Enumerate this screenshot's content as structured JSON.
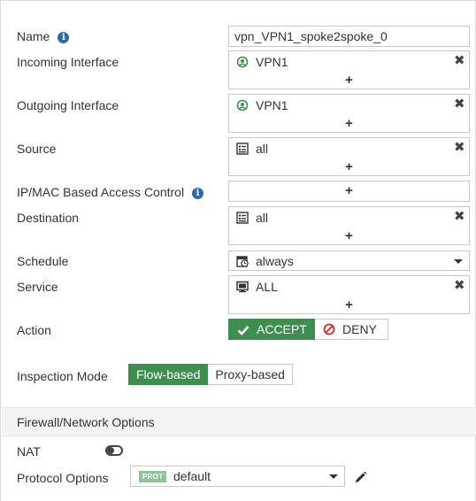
{
  "form": {
    "name": {
      "label": "Name",
      "value": "vpn_VPN1_spoke2spoke_0"
    },
    "incoming_interface": {
      "label": "Incoming Interface",
      "entry": "VPN1"
    },
    "outgoing_interface": {
      "label": "Outgoing Interface",
      "entry": "VPN1"
    },
    "source": {
      "label": "Source",
      "entry": "all"
    },
    "ipmac": {
      "label": "IP/MAC Based Access Control"
    },
    "destination": {
      "label": "Destination",
      "entry": "all"
    },
    "schedule": {
      "label": "Schedule",
      "value": "always"
    },
    "service": {
      "label": "Service",
      "entry": "ALL"
    },
    "action": {
      "label": "Action",
      "accept": "ACCEPT",
      "deny": "DENY",
      "selected": "ACCEPT"
    },
    "inspection_mode": {
      "label": "Inspection Mode",
      "flow": "Flow-based",
      "proxy": "Proxy-based",
      "selected": "Flow-based"
    }
  },
  "section": {
    "title": "Firewall/Network Options"
  },
  "nat": {
    "label": "NAT",
    "enabled": false
  },
  "protocol_options": {
    "label": "Protocol Options",
    "badge": "PROT",
    "value": "default"
  },
  "symbols": {
    "info": "i",
    "remove": "✖",
    "add": "+"
  },
  "colors": {
    "accent_green": "#3e8e4f",
    "info_blue": "#2a6bb3",
    "deny_red": "#d9252b",
    "badge_green": "#8fc39a"
  }
}
